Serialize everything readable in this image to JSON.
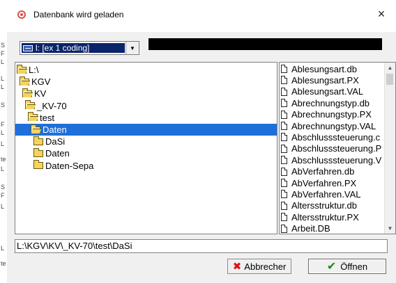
{
  "window": {
    "title": "Datenbank wird geladen",
    "close_label": "×"
  },
  "background_strip": [
    "S",
    "F",
    "L",
    "L",
    "L",
    "S",
    "F",
    "L",
    "L",
    "te",
    "L",
    "S",
    "F",
    "L",
    "L",
    "te"
  ],
  "drive": {
    "selected": "l: [ex 1 coding]"
  },
  "folders": [
    {
      "label": "L:\\",
      "open": true,
      "indent": 0
    },
    {
      "label": "KGV",
      "open": true,
      "indent": 1
    },
    {
      "label": "KV",
      "open": true,
      "indent": 2
    },
    {
      "label": "_KV-70",
      "open": true,
      "indent": 3
    },
    {
      "label": "test",
      "open": true,
      "indent": 4
    },
    {
      "label": "Daten",
      "open": true,
      "indent": 5,
      "selected": true
    },
    {
      "label": "DaSi",
      "open": false,
      "indent": 6
    },
    {
      "label": "Daten",
      "open": false,
      "indent": 6
    },
    {
      "label": "Daten-Sepa",
      "open": false,
      "indent": 6
    }
  ],
  "files": [
    "Ablesungsart.db",
    "Ablesungsart.PX",
    "Ablesungsart.VAL",
    "Abrechnungstyp.db",
    "Abrechnungstyp.PX",
    "Abrechnungstyp.VAL",
    "Abschlusssteuerung.c",
    "Abschlusssteuerung.P",
    "Abschlusssteuerung.V",
    "AbVerfahren.db",
    "AbVerfahren.PX",
    "AbVerfahren.VAL",
    "Altersstruktur.db",
    "Altersstruktur.PX",
    "Arbeit.DB"
  ],
  "path": "L:\\KGV\\KV\\_KV-70\\test\\DaSi",
  "buttons": {
    "cancel_label": "Abbrecher",
    "ok_label": "Öffnen"
  }
}
